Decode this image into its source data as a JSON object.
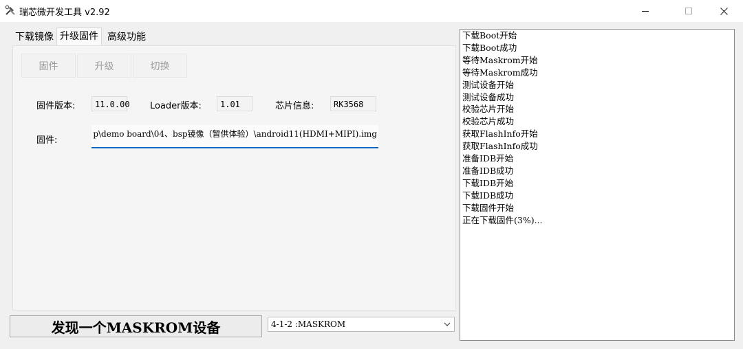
{
  "window": {
    "title": "瑞芯微开发工具 v2.92"
  },
  "tabs": [
    {
      "label": "下载镜像"
    },
    {
      "label": "升级固件"
    },
    {
      "label": "高级功能"
    }
  ],
  "toolbar": {
    "firmware_label": "固件",
    "upgrade_label": "升级",
    "switch_label": "切换"
  },
  "info": {
    "firmware_version_label": "固件版本:",
    "firmware_version": "11.0.00",
    "loader_version_label": "Loader版本:",
    "loader_version": "1.01",
    "chip_info_label": "芯片信息:",
    "chip_info": "RK3568",
    "firmware_label": "固件:",
    "firmware_path": "p\\demo board\\04、bsp镜像（暂供体验）\\android11(HDMI+MIPI).img"
  },
  "status": {
    "message": "发现一个MASKROM设备",
    "device": "4-1-2 :MASKROM"
  },
  "log": [
    "下载Boot开始",
    "下载Boot成功",
    "等待Maskrom开始",
    "等待Maskrom成功",
    "测试设备开始",
    "测试设备成功",
    "校验芯片开始",
    "校验芯片成功",
    "获取FlashInfo开始",
    "获取FlashInfo成功",
    "准备IDB开始",
    "准备IDB成功",
    "下载IDB开始",
    "下载IDB成功",
    "下载固件开始",
    "正在下载固件(3%)..."
  ]
}
